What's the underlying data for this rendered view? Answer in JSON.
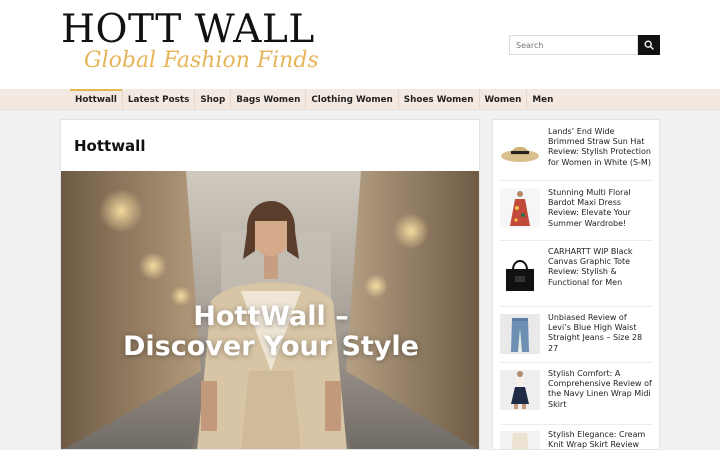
{
  "site": {
    "logo_text": "HOTT WALL",
    "tagline": "Global Fashion Finds"
  },
  "search": {
    "placeholder": "Search",
    "value": ""
  },
  "nav": {
    "items": [
      {
        "label": "Hottwall",
        "active": true
      },
      {
        "label": "Latest Posts"
      },
      {
        "label": "Shop"
      },
      {
        "label": "Bags Women"
      },
      {
        "label": "Clothing Women"
      },
      {
        "label": "Shoes Women"
      },
      {
        "label": "Women"
      },
      {
        "label": "Men"
      }
    ]
  },
  "main": {
    "title": "Hottwall",
    "hero": {
      "line1": "HottWall –",
      "line2": "Discover Your Style",
      "image_icon": "fashion-model-photo"
    }
  },
  "sidebar": {
    "posts": [
      {
        "title": "Lands’ End Wide Brimmed Straw Sun Hat Review: Stylish Protection for Women in White (S-M)",
        "thumb_icon": "straw-hat-icon"
      },
      {
        "title": "Stunning Multi Floral Bardot Maxi Dress Review: Elevate Your Summer Wardrobe!",
        "thumb_icon": "floral-dress-icon"
      },
      {
        "title": "CARHARTT WIP Black Canvas Graphic Tote Review: Stylish & Functional for Men",
        "thumb_icon": "tote-bag-icon"
      },
      {
        "title": "Unbiased Review of Levi’s Blue High Waist Straight Jeans – Size 28 27",
        "thumb_icon": "jeans-icon"
      },
      {
        "title": "Stylish Comfort: A Comprehensive Review of the Navy Linen Wrap Midi Skirt",
        "thumb_icon": "skirt-icon"
      },
      {
        "title": "Stylish Elegance: Cream Knit Wrap Skirt Review for",
        "thumb_icon": "knit-skirt-icon"
      }
    ]
  },
  "colors": {
    "nav_bg": "#f4e9e0",
    "accent": "#e6b55a",
    "search_button": "#111111"
  }
}
